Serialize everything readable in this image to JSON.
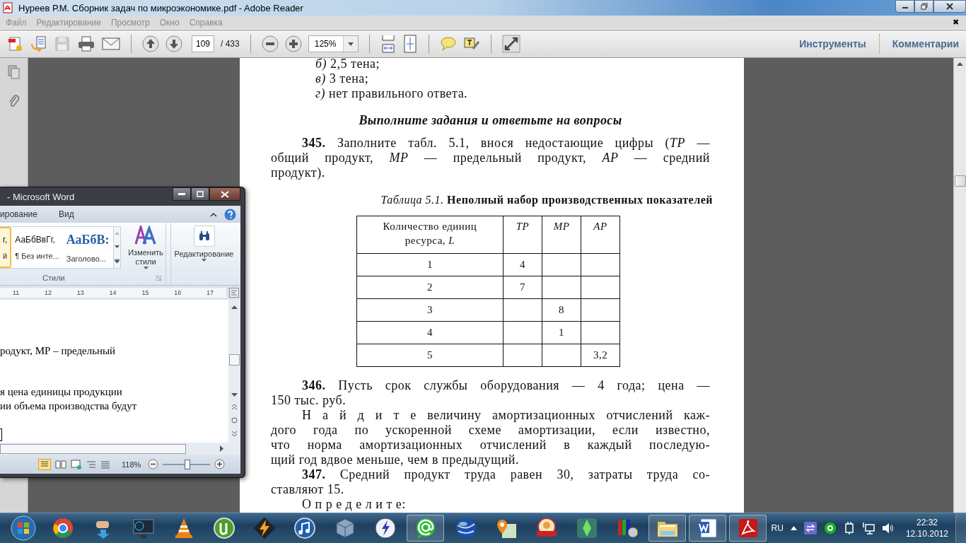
{
  "reader": {
    "title": "Нуреев Р.М. Сборник задач по микроэкономике.pdf - Adobe Reader",
    "menu": [
      "Файл",
      "Редактирование",
      "Просмотр",
      "Окно",
      "Справка"
    ],
    "close_mark": "✖",
    "toolbar": {
      "page": "109",
      "page_total": "/ 433",
      "zoom": "125%",
      "panels": [
        "Инструменты",
        "Комментарии"
      ]
    },
    "page": {
      "options": [
        "*б)* 2,5 тена;",
        "*в)* 3 тена;",
        "*г)* нет правильного ответа."
      ],
      "heading": "Выполните задания и ответьте на вопросы",
      "intro": {
        "lines": [
          "**345.** Заполните табл. 5.1, внося недостающие цифры (*TP* —",
          "общий продукт, *MP* — предельный продукт, *AP* — средний",
          "продукт)."
        ]
      },
      "caption": "*Таблица 5.1.* **Неполный набор производственных показателей**",
      "table": {
        "columns": [
          "Количество единиц ресурса, *L*",
          "*TP*",
          "*MP*",
          "*AP*"
        ],
        "rows": [
          [
            "1",
            "4",
            "",
            ""
          ],
          [
            "2",
            "7",
            "",
            ""
          ],
          [
            "3",
            "",
            "8",
            ""
          ],
          [
            "4",
            "",
            "1",
            ""
          ],
          [
            "5",
            "",
            "",
            "3,2"
          ]
        ]
      },
      "paragraphs": [
        {
          "lines": [
            "**346.** Пусть срок службы оборудования — 4 года; цена —",
            "150 тыс. руб."
          ]
        },
        {
          "lines": [
            "Н а й д и т е величину амортизационных отчислений каж-",
            "дого года по ускоренной схеме амортизации, если известно,",
            "что норма амортизационных отчислений в каждый последую-",
            "щий год вдвое меньше, чем в предыдущий."
          ]
        },
        {
          "lines": [
            "**347.** Средний продукт труда равен 30, затраты труда со-",
            "ставляют 15."
          ]
        },
        {
          "lines": [
            "О п р е д е л и т е:"
          ]
        }
      ]
    }
  },
  "word": {
    "title": "- Microsoft Word",
    "tabs": [
      "ирование",
      "Вид"
    ],
    "styles": [
      {
        "sample": "г,",
        "name": "й",
        "selected": true
      },
      {
        "sample": "АаБбВвГг,",
        "name": "¶ Без инте...",
        "selected": false
      },
      {
        "sample": "АаБбВ:",
        "name": "Заголово...",
        "selected": false
      }
    ],
    "change_styles": "Изменить стили",
    "editing": "Редактирование",
    "group": "Стили",
    "ruler": [
      "11",
      "12",
      "13",
      "14",
      "15",
      "16",
      "17"
    ],
    "paragraphs": [
      [
        "родукт, МР – предельный"
      ],
      [
        "я цена единицы продукции",
        "ии объема производства будут"
      ]
    ],
    "zoom": "118%",
    "zoom_slider": {
      "level": 0.52
    }
  },
  "taskbar": {
    "apps": [
      {
        "kind": "browser",
        "running": false
      },
      {
        "kind": "download",
        "running": false
      },
      {
        "kind": "monitor",
        "running": false
      },
      {
        "kind": "cone",
        "running": false
      },
      {
        "kind": "torrent",
        "running": false
      },
      {
        "kind": "bolt",
        "running": false
      },
      {
        "kind": "music",
        "running": false
      },
      {
        "kind": "cube",
        "running": false
      },
      {
        "kind": "disk",
        "running": false
      },
      {
        "kind": "chat",
        "running": true
      },
      {
        "kind": "globe",
        "running": false
      },
      {
        "kind": "pin",
        "running": false
      },
      {
        "kind": "game",
        "running": false
      },
      {
        "kind": "gem",
        "running": false
      },
      {
        "kind": "books",
        "running": false
      },
      {
        "kind": "folder",
        "running": true
      },
      {
        "kind": "document",
        "running": true
      },
      {
        "kind": "pdf",
        "running": true
      }
    ],
    "language": "RU",
    "time": "22:32",
    "date": "12.10.2012"
  }
}
